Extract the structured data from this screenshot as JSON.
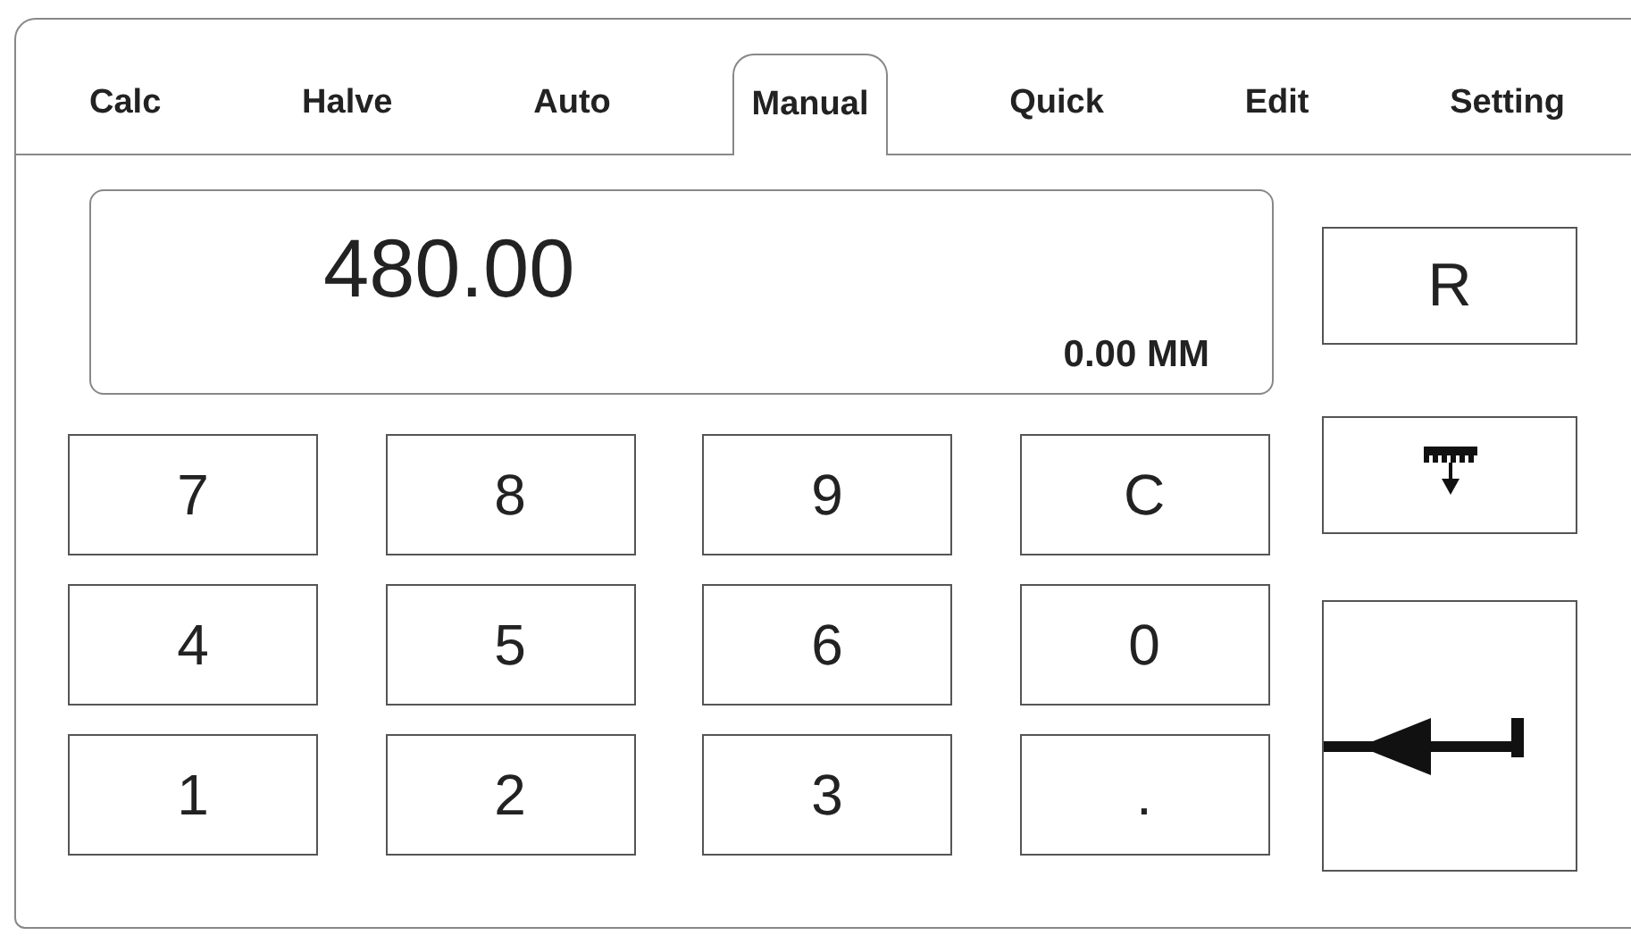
{
  "tabs": [
    {
      "label": "Calc",
      "selected": false
    },
    {
      "label": "Halve",
      "selected": false
    },
    {
      "label": "Auto",
      "selected": false
    },
    {
      "label": "Manual",
      "selected": true
    },
    {
      "label": "Quick",
      "selected": false
    },
    {
      "label": "Edit",
      "selected": false
    },
    {
      "label": "Setting",
      "selected": false
    }
  ],
  "display": {
    "value": "480.00",
    "reading": "0.00 MM"
  },
  "keys": [
    "7",
    "8",
    "9",
    "C",
    "4",
    "5",
    "6",
    "0",
    "1",
    "2",
    "3",
    "."
  ],
  "side_buttons": [
    {
      "kind": "text",
      "label": "R"
    },
    {
      "kind": "ruler"
    },
    {
      "kind": "enter"
    }
  ]
}
